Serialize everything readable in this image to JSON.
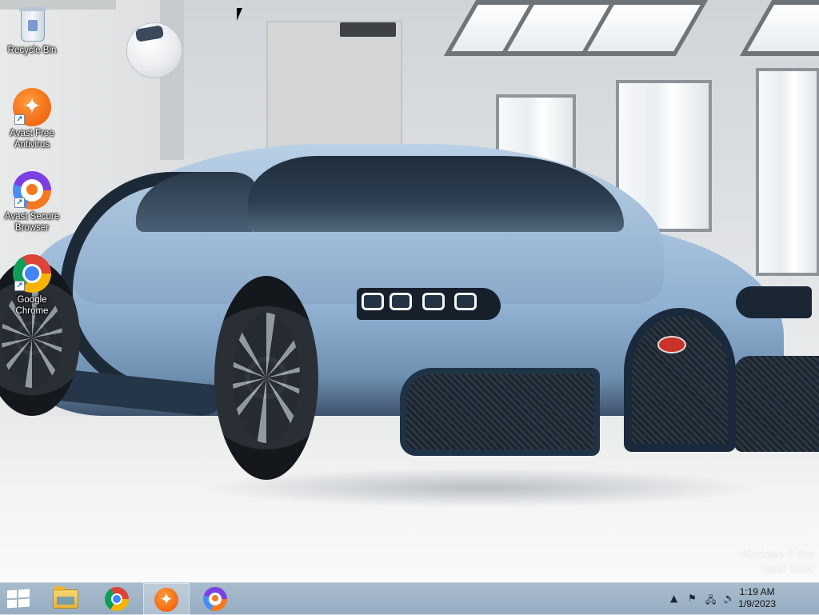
{
  "desktop": {
    "icons": [
      {
        "label_lines": [
          "Recycle Bin"
        ],
        "icon": "recycle-bin-icon"
      },
      {
        "label_lines": [
          "Avast Free",
          "Antivirus"
        ],
        "icon": "avast-antivirus-icon"
      },
      {
        "label_lines": [
          "Avast Secure",
          "Browser"
        ],
        "icon": "avast-secure-browser-icon"
      },
      {
        "label_lines": [
          "Google",
          "Chrome"
        ],
        "icon": "google-chrome-icon"
      }
    ],
    "watermark": {
      "line1": "Windows 8 Pro",
      "line2": "Build 9200"
    }
  },
  "taskbar": {
    "buttons": [
      {
        "name": "start",
        "icon": "windows-logo-icon"
      },
      {
        "name": "file-explorer",
        "icon": "folder-icon"
      },
      {
        "name": "google-chrome",
        "icon": "google-chrome-icon"
      },
      {
        "name": "avast-free-antivirus",
        "icon": "avast-antivirus-icon",
        "active": true
      },
      {
        "name": "avast-secure-browser",
        "icon": "avast-secure-browser-icon"
      }
    ],
    "tray": {
      "icons": [
        "chevron-up-icon",
        "flag-icon",
        "network-icon",
        "speaker-icon"
      ],
      "time": "1:19 AM",
      "date": "1/9/2023"
    }
  },
  "colors": {
    "taskbar": "#a3b7c9",
    "avast_orange": "#f26a13",
    "chrome_blue": "#4285f4"
  }
}
